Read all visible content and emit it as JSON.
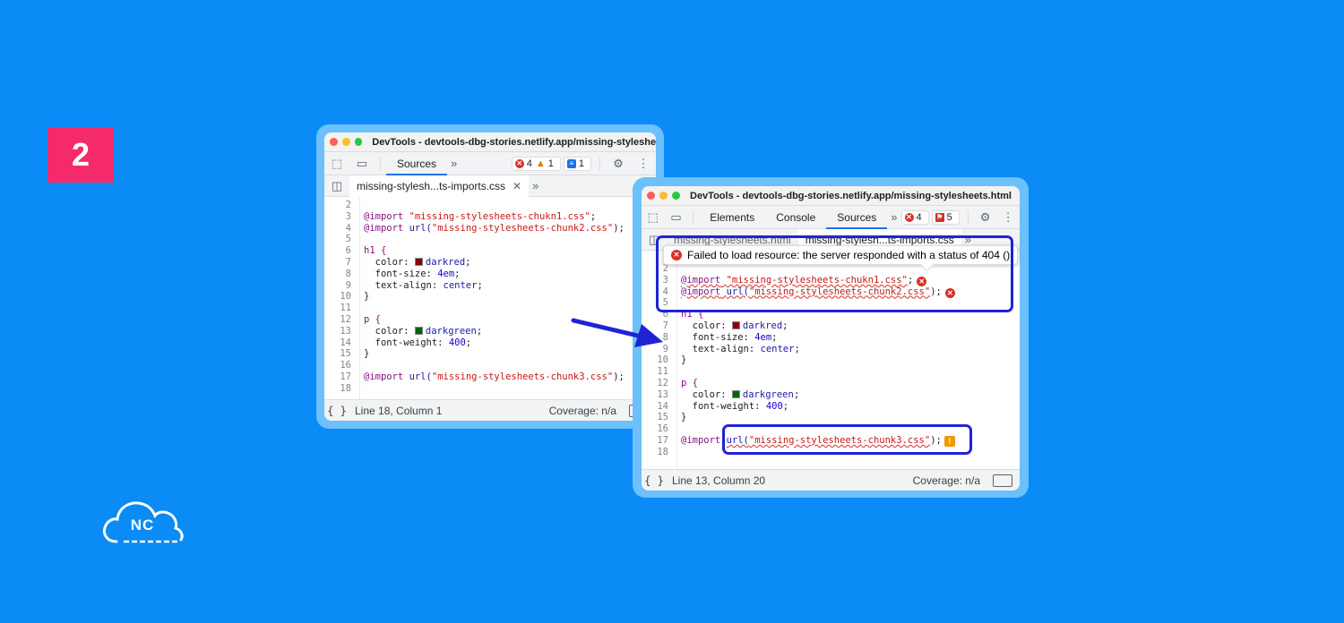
{
  "step": {
    "number": "2"
  },
  "logo": {
    "text": "NC"
  },
  "left_window": {
    "title": "DevTools - devtools-dbg-stories.netlify.app/missing-styleshe...",
    "tabs": [
      {
        "label": "Sources"
      }
    ],
    "counters": {
      "errors": "4",
      "warnings": "1",
      "messages": "1"
    },
    "file_tab": "missing-stylesh...ts-imports.css",
    "lines": [
      "2",
      "3",
      "4",
      "5",
      "6",
      "7",
      "8",
      "9",
      "10",
      "11",
      "12",
      "13",
      "14",
      "15",
      "16",
      "17",
      "18"
    ],
    "code": {
      "l3_at": "@import",
      "l3_str": "\"missing-stylesheets-chukn1.css\"",
      "l3_end": ";",
      "l4_at": "@import",
      "l4_fn": "url(",
      "l4_str": "\"missing-stylesheets-chunk2.css\"",
      "l4_end": ");",
      "l6": "h1 {",
      "l7_prop": "  color: ",
      "l7_val": "darkred",
      "l7_end": ";",
      "l8_prop": "  font-size: ",
      "l8_val": "4em",
      "l8_end": ";",
      "l9_prop": "  text-align: ",
      "l9_val": "center",
      "l9_end": ";",
      "l10": "}",
      "l12": "p {",
      "l13_prop": "  color: ",
      "l13_val": "darkgreen",
      "l13_end": ";",
      "l14_prop": "  font-weight: ",
      "l14_val": "400",
      "l14_end": ";",
      "l15": "}",
      "l17_at": "@import",
      "l17_fn": "url(",
      "l17_str": "\"missing-stylesheets-chunk3.css\"",
      "l17_end": ");"
    },
    "status": {
      "position": "Line 18, Column 1",
      "coverage": "Coverage: n/a"
    }
  },
  "right_window": {
    "title": "DevTools - devtools-dbg-stories.netlify.app/missing-stylesheets.html",
    "tabs": [
      {
        "label": "Elements"
      },
      {
        "label": "Console"
      },
      {
        "label": "Sources"
      }
    ],
    "counters": {
      "errors": "4",
      "issues": "5"
    },
    "file_tabs": [
      "missing-stylesheets.html",
      "missing-stylesh...ts-imports.css"
    ],
    "tooltip": "Failed to load resource: the server responded with a status of 404 ()",
    "lines": [
      "2",
      "3",
      "4",
      "5",
      "6",
      "7",
      "8",
      "9",
      "10",
      "11",
      "12",
      "13",
      "14",
      "15",
      "16",
      "17",
      "18"
    ],
    "code": {
      "l3_at": "@import",
      "l3_str": "\"missing-stylesheets-chukn1.css\"",
      "l3_end": ";",
      "l4_at": "@import",
      "l4_fn": "url(",
      "l4_str": "\"missing-stylesheets-chunk2.css\"",
      "l4_end": ");",
      "l6": "h1 {",
      "l7_prop": "  color: ",
      "l7_val": "darkred",
      "l7_end": ";",
      "l8_prop": "  font-size: ",
      "l8_val": "4em",
      "l8_end": ";",
      "l9_prop": "  text-align: ",
      "l9_val": "center",
      "l9_end": ";",
      "l10": "}",
      "l12": "p {",
      "l13_prop": "  color: ",
      "l13_val": "darkgreen",
      "l13_end": ";",
      "l14_prop": "  font-weight: ",
      "l14_val": "400",
      "l14_end": ";",
      "l15": "}",
      "l17_at": "@import",
      "l17_fn": "url(",
      "l17_str": "\"missing-stylesheets-chunk3.css\"",
      "l17_end": ");"
    },
    "status": {
      "position": "Line 13, Column 20",
      "coverage": "Coverage: n/a"
    }
  },
  "colors": {
    "background": "#0a8bf5",
    "badge": "#f52a6b",
    "highlight": "#1f23d6",
    "darkred": "#8b0000",
    "darkgreen": "#006400"
  }
}
